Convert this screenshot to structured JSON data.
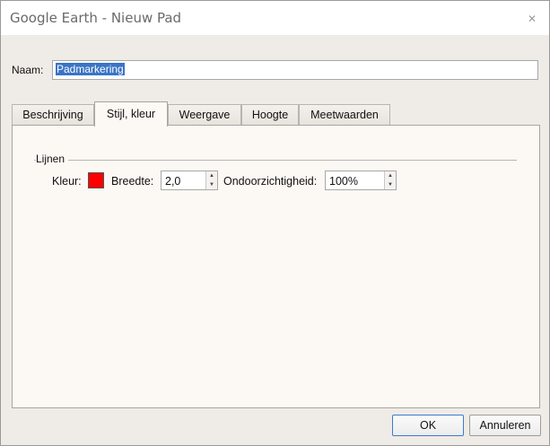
{
  "window": {
    "title": "Google Earth - Nieuw Pad",
    "close_glyph": "✕"
  },
  "name_field": {
    "label": "Naam:",
    "value": "Padmarkering"
  },
  "tabs": [
    {
      "label": "Beschrijving",
      "active": false
    },
    {
      "label": "Stijl, kleur",
      "active": true
    },
    {
      "label": "Weergave",
      "active": false
    },
    {
      "label": "Hoogte",
      "active": false
    },
    {
      "label": "Meetwaarden",
      "active": false
    }
  ],
  "lines_group": {
    "title": "Lijnen",
    "color_label": "Kleur:",
    "color_value": "#ff0000",
    "width_label": "Breedte:",
    "width_value": "2,0",
    "opacity_label": "Ondoorzichtigheid:",
    "opacity_value": "100%"
  },
  "buttons": {
    "ok": "OK",
    "cancel": "Annuleren"
  },
  "icons": {
    "close": "close-icon",
    "spin_up": "spin-up-arrow-icon",
    "spin_down": "spin-down-arrow-icon"
  }
}
